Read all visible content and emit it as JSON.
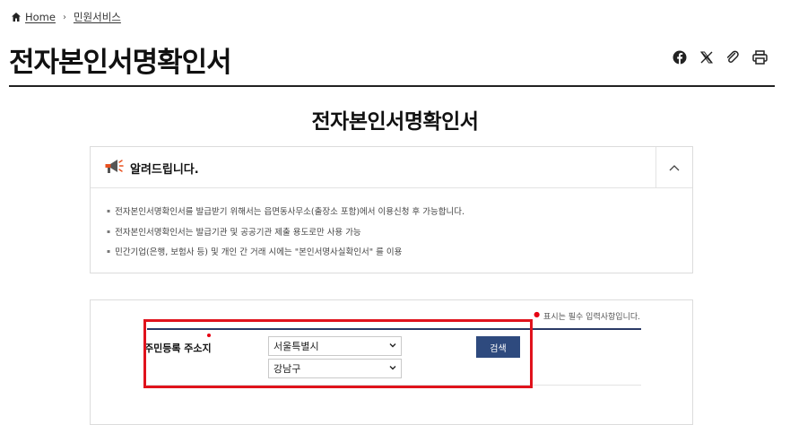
{
  "breadcrumb": {
    "home": "Home",
    "separator": "›",
    "current": "민원서비스"
  },
  "page_title": "전자본인서명확인서",
  "share_icons": [
    "facebook-icon",
    "x-icon",
    "clip-icon",
    "print-icon"
  ],
  "content_title": "전자본인서명확인서",
  "notice": {
    "title": "알려드립니다.",
    "items": [
      "전자본인서명확인서를 발급받기 위해서는 읍면동사무소(출장소 포함)에서 이용신청 후 가능합니다.",
      "전자본인서명확인서는 발급기관 및 공공기관 제출 용도로만 사용 가능",
      "민간기업(은행, 보험사 등) 및 개인 간 거래 시에는 \"본인서명사실확인서\" 를 이용"
    ]
  },
  "form": {
    "required_note": "표시는 필수 입력사항입니다.",
    "label": "주민등록 주소지",
    "city_value": "서울특별시",
    "district_value": "강남구",
    "search_label": "검색"
  },
  "colors": {
    "accent_navy": "#2e4a7e",
    "required_red": "#e60012",
    "highlight_red": "#e0121c"
  }
}
